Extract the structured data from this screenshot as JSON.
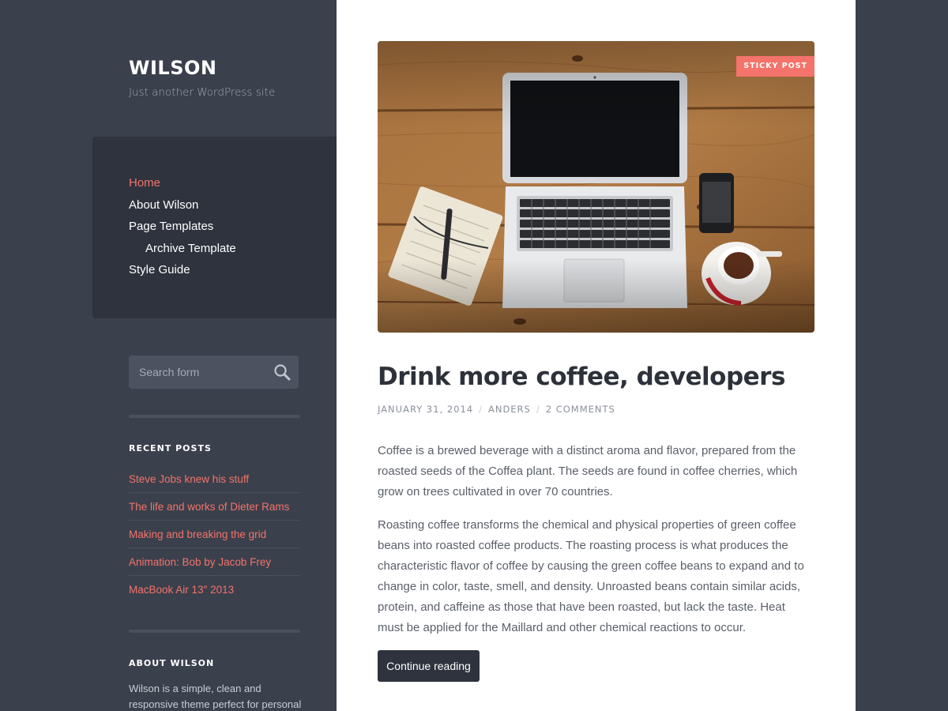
{
  "site": {
    "title": "WILSON",
    "description": "Just another WordPress site"
  },
  "nav": {
    "items": [
      {
        "label": "Home"
      },
      {
        "label": "About Wilson"
      },
      {
        "label": "Page Templates"
      },
      {
        "label": "Archive Template"
      },
      {
        "label": "Style Guide"
      }
    ]
  },
  "search": {
    "placeholder": "Search form"
  },
  "recent_posts": {
    "title": "RECENT POSTS",
    "items": [
      {
        "label": "Steve Jobs knew his stuff"
      },
      {
        "label": "The life and works of Dieter Rams"
      },
      {
        "label": "Making and breaking the grid"
      },
      {
        "label": "Animation: Bob by Jacob Frey"
      },
      {
        "label": "MacBook Air 13″ 2013"
      }
    ]
  },
  "about": {
    "title": "ABOUT WILSON",
    "text": "Wilson is a simple, clean and responsive theme perfect for personal"
  },
  "post": {
    "badge": "STICKY POST",
    "title": "Drink more coffee, developers",
    "date": "JANUARY 31, 2014",
    "author": "ANDERS",
    "comments": "2 COMMENTS",
    "sep": "/",
    "paragraphs": [
      "Coffee is a brewed beverage with a distinct aroma and flavor, prepared from the roasted seeds of the Coffea plant. The seeds are found in coffee cherries, which grow on trees cultivated in over 70 countries.",
      "Roasting coffee transforms the chemical and physical properties of green coffee beans into roasted coffee products. The roasting process is what produces the characteristic flavor of coffee by causing the green coffee beans to expand and to change in color, taste, smell, and density. Unroasted beans contain similar acids, protein, and caffeine as those that have been roasted, but lack the taste. Heat must be applied for the Maillard and other chemical reactions to occur."
    ],
    "continue_label": "Continue reading"
  },
  "colors": {
    "sidebar_bg": "#3a404c",
    "nav_bg": "#2e333d",
    "accent": "#f4736b",
    "content_bg": "#ffffff"
  },
  "icons": {
    "search": "magnifier-icon"
  }
}
